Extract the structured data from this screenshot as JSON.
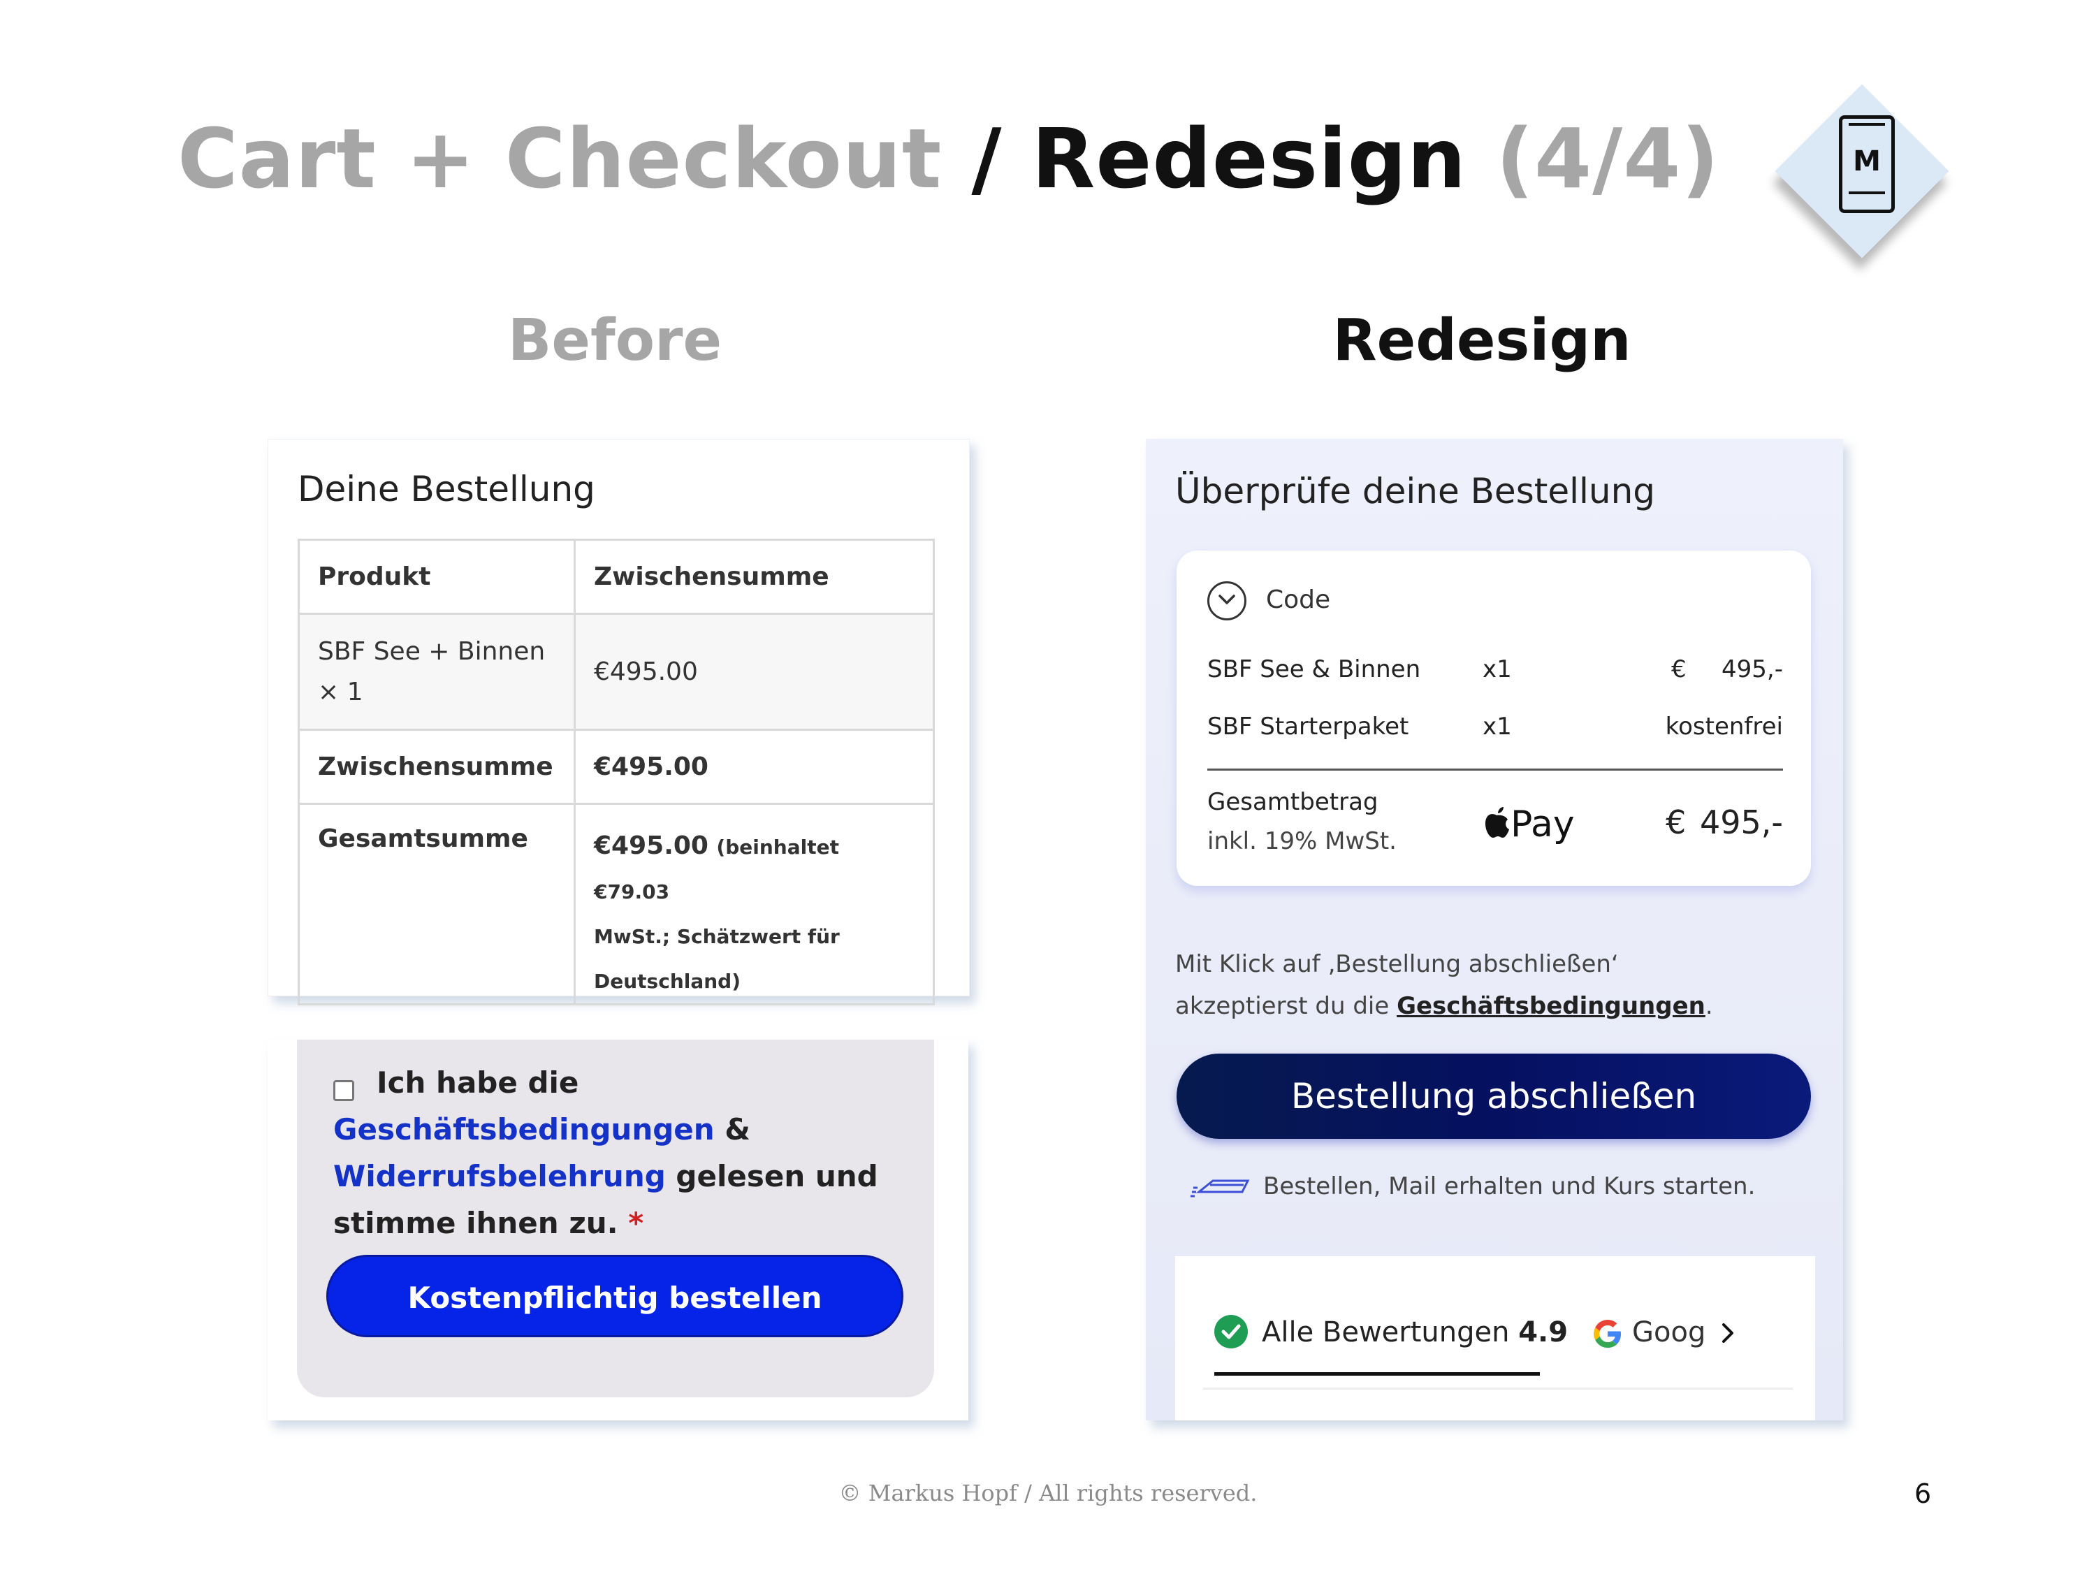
{
  "slide": {
    "title_part1": "Cart + Checkout",
    "title_part2": " / Redesign",
    "title_part3": " (4/4)",
    "logo_letter": "M",
    "before_heading": "Before",
    "redesign_heading": "Redesign",
    "footer": "© Markus Hopf / All rights reserved.",
    "page_number": "6"
  },
  "before": {
    "heading": "Deine Bestellung",
    "table": {
      "col_product": "Produkt",
      "col_subtotal": "Zwischensumme",
      "item_name": "SBF See + Binnen",
      "item_qty": "× 1",
      "item_price": "€495.00",
      "subtotal_label": "Zwischensumme",
      "subtotal_value": "€495.00",
      "total_label": "Gesamtsumme",
      "total_value": "€495.00",
      "total_note_1": "(beinhaltet €79.03",
      "total_note_2": "MwSt.; Schätzwert für",
      "total_note_3": "Deutschland)"
    },
    "agree_1": "Ich habe die",
    "agree_link_1": "Geschäftsbedingungen",
    "agree_amp": " &",
    "agree_link_2": "Widerrufsbelehrung",
    "agree_2": " gelesen und stimme ihnen zu.",
    "agree_star": " *",
    "order_button": "Kostenpflichtig bestellen"
  },
  "redesign": {
    "heading": "Überprüfe deine Bestellung",
    "code_label": "Code",
    "items": [
      {
        "name": "SBF See & Binnen",
        "qty": "x1",
        "currency": "€",
        "price": "495,-"
      },
      {
        "name": "SBF Starterpaket",
        "qty": "x1",
        "currency": "",
        "price": "kostenfrei"
      }
    ],
    "total_label": "Gesamtbetrag",
    "total_vat": "inkl. 19% MwSt.",
    "apple_pay": "Pay",
    "total_currency": "€",
    "total_price": "495,-",
    "terms_1": "Mit Klick auf ‚Bestellung abschließen‘",
    "terms_2": "akzeptierst du die ",
    "terms_link": "Geschäftsbedingungen",
    "terms_end": ".",
    "order_button": "Bestellung abschließen",
    "cta_note": "Bestellen, Mail erhalten und Kurs starten.",
    "reviews_label": "Alle Bewertungen ",
    "reviews_score": "4.9",
    "google_text": "Goog"
  },
  "colors": {
    "before_button": "#0624e8",
    "redesign_button": "#051060",
    "link_blue": "#1432c8",
    "review_green": "#1f9d55"
  }
}
